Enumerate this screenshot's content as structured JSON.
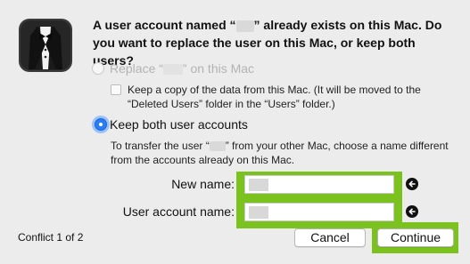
{
  "dialog": {
    "heading_part1": "A user account named “",
    "heading_part2": "” already exists on this Mac. Do you want to replace the user on this Mac, or keep both users?"
  },
  "options": {
    "replace": {
      "label_prefix": "Replace “",
      "label_suffix": "” on this Mac",
      "selected": false,
      "enabled": false
    },
    "keep_copy": {
      "label": "Keep a copy of the data from this Mac. (It will be moved to the “Deleted Users” folder in the “Users” folder.)",
      "checked": false
    },
    "keep_both": {
      "label": "Keep both user accounts",
      "selected": true
    }
  },
  "transfer_note_part1": "To transfer the user “",
  "transfer_note_part2": "” from your other Mac, choose a name different from the accounts already on this Mac.",
  "fields": {
    "new_name_label": "New name:",
    "account_name_label": "User account name:"
  },
  "footer": {
    "conflict": "Conflict 1 of 2",
    "cancel": "Cancel",
    "continue": "Continue"
  },
  "colors": {
    "highlight": "#7bc21f",
    "radio_selected": "#2a7cf6"
  },
  "icons": {
    "app": "tuxedo-icon",
    "info": "back-arrow-icon"
  }
}
